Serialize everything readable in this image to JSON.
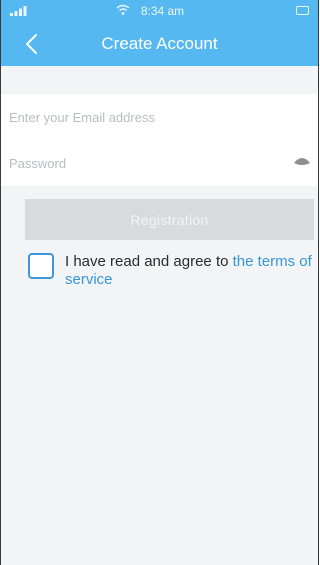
{
  "status_bar": {
    "time": "8:34 am",
    "icons": [
      "signal-icon",
      "wifi-icon",
      "battery-icon"
    ]
  },
  "nav": {
    "back_icon": "chevron-left-icon",
    "title": "Create Account"
  },
  "form": {
    "email_placeholder": "Enter your Email address",
    "password_placeholder": "Password",
    "password_toggle_icon": "eye-icon",
    "register_label": "Registration"
  },
  "agreement": {
    "text": "I have read and agree to ",
    "link": "the terms of service",
    "checked": false
  },
  "colors": {
    "header": "#55b8f0",
    "link": "#3597d6",
    "checkbox_border": "#3f97d9",
    "button_disabled": "#d9dadc",
    "background": "#f3f4f6"
  }
}
